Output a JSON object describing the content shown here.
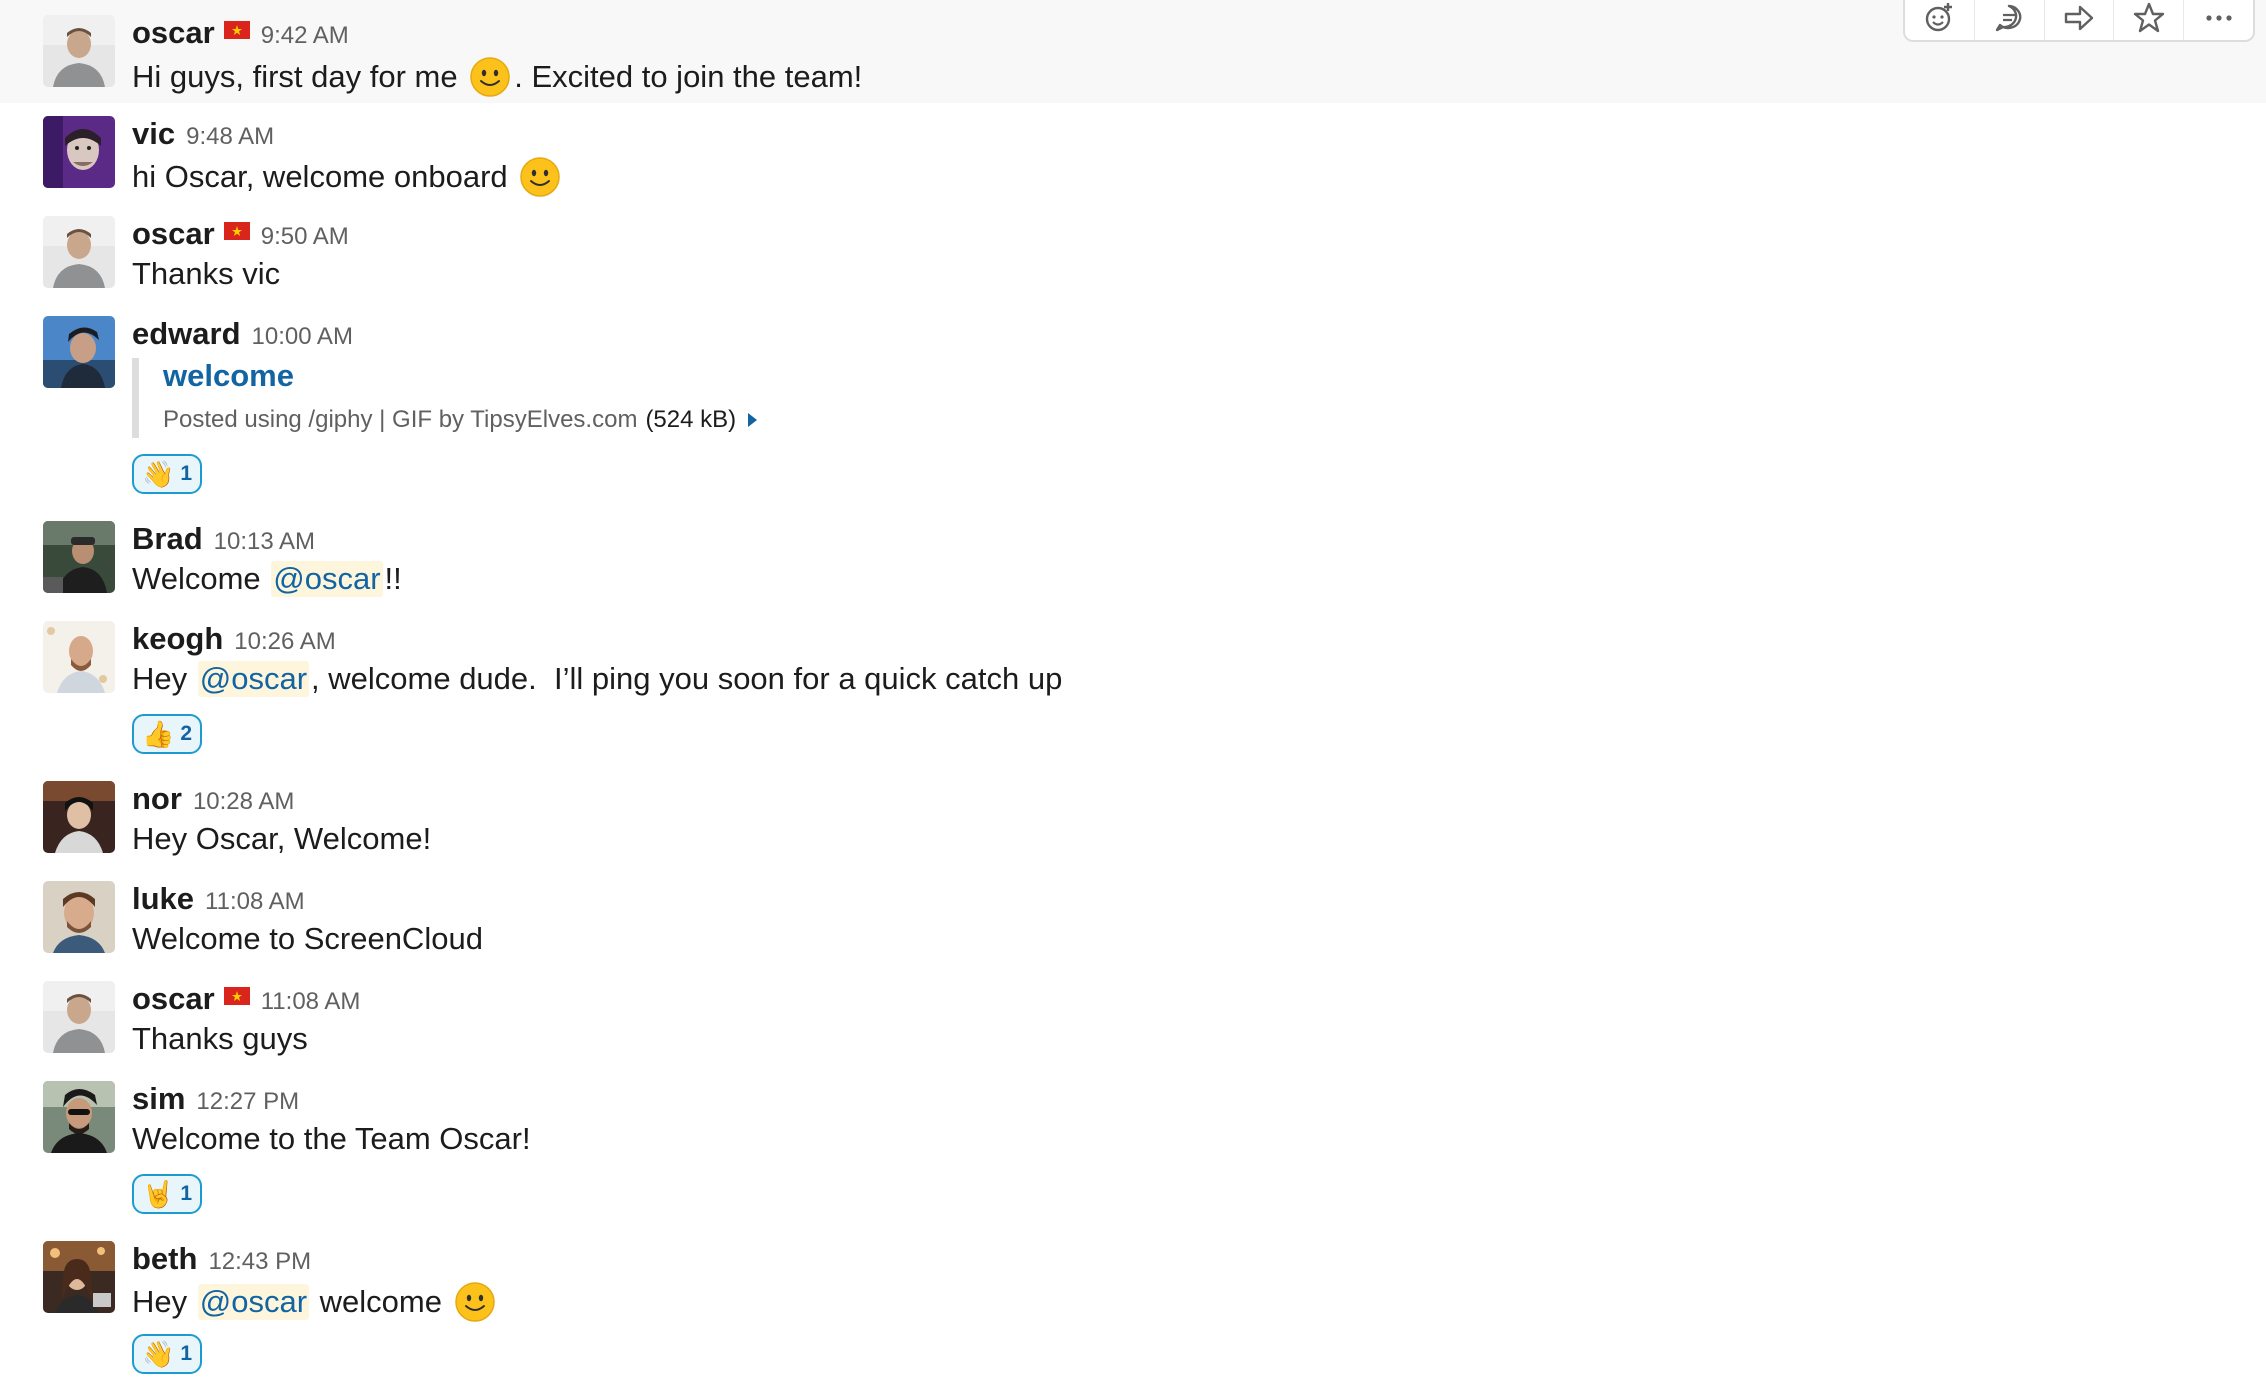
{
  "toolbar": {
    "icons": [
      "add-reaction-icon",
      "start-thread-icon",
      "share-message-icon",
      "star-icon",
      "more-actions-icon"
    ]
  },
  "colors": {
    "link": "#1264a3",
    "mention_bg": "#fef6dc",
    "reaction_border": "#1d9bd1",
    "reaction_bg": "#e8f5fa",
    "hover_bg": "#f8f8f8",
    "timestamp": "#616061"
  },
  "messages": [
    {
      "author": "oscar",
      "flag": "flag-vietnam-icon",
      "time": "9:42 AM",
      "text_before": "Hi guys, first day for me ",
      "emoji": "slightly-smiling-face-icon",
      "text_after": ". Excited to join the team!"
    },
    {
      "author": "vic",
      "time": "9:48 AM",
      "text_before": "hi Oscar, welcome onboard ",
      "emoji": "slightly-smiling-face-icon"
    },
    {
      "author": "oscar",
      "flag": "flag-vietnam-icon",
      "time": "9:50 AM",
      "text": "Thanks vic"
    },
    {
      "author": "edward",
      "time": "10:00 AM",
      "attachment": {
        "title": "welcome",
        "footer": "Posted using /giphy | GIF by TipsyElves.com",
        "size": "(524 kB)"
      },
      "reaction": {
        "icon": "waving-hand-icon",
        "glyph": "👋",
        "count": "1"
      }
    },
    {
      "author": "Brad",
      "time": "10:13 AM",
      "text_before": "Welcome ",
      "mention": "@oscar",
      "text_after": "!!"
    },
    {
      "author": "keogh",
      "time": "10:26 AM",
      "text_before": "Hey ",
      "mention": "@oscar",
      "text_after": ", welcome dude.  I’ll ping you soon for a quick catch up",
      "reaction": {
        "icon": "thumbs-up-icon",
        "glyph": "👍",
        "count": "2"
      }
    },
    {
      "author": "nor",
      "time": "10:28 AM",
      "text": "Hey Oscar, Welcome!"
    },
    {
      "author": "luke",
      "time": "11:08 AM",
      "text": "Welcome to ScreenCloud"
    },
    {
      "author": "oscar",
      "flag": "flag-vietnam-icon",
      "time": "11:08 AM",
      "text": "Thanks guys"
    },
    {
      "author": "sim",
      "time": "12:27 PM",
      "text": "Welcome to the Team Oscar!",
      "reaction": {
        "icon": "sign-of-the-horns-icon",
        "glyph": "🤘",
        "count": "1"
      }
    },
    {
      "author": "beth",
      "time": "12:43 PM",
      "text_before": "Hey ",
      "mention": "@oscar",
      "text_after": " welcome ",
      "emoji": "slightly-smiling-face-icon",
      "reaction": {
        "icon": "waving-hand-icon",
        "glyph": "👋",
        "count": "1"
      }
    }
  ]
}
